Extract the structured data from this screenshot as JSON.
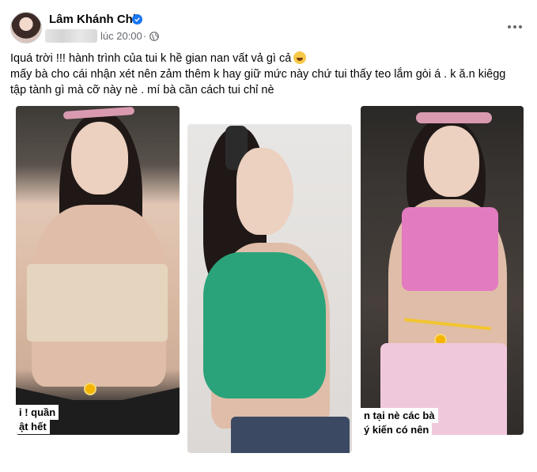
{
  "post": {
    "author_name": "Lâm Khánh Chi",
    "timestamp": "lúc 20:00",
    "separator": "·",
    "caption_lines": [
      "Iquá trời !!! hành trình của tui k hề gian nan vất vả gì cả",
      "mấy bà cho cái nhận xét nên zảm thêm k hay giữ mức này chứ tui thấy teo lắm gòi á . k ă.n kiêgg",
      "tập tành gì mà cỡ này nè . mí bà cần cách tui chỉ nè"
    ]
  },
  "photos": [
    {
      "stickers": [
        "i ! quần",
        "ật hết"
      ]
    },
    {
      "stickers": []
    },
    {
      "stickers": [
        "n tại nè các bà",
        "ý kiến có nên"
      ]
    }
  ],
  "icons": {
    "verified": "verified-badge-icon",
    "privacy": "globe-icon",
    "more": "more-options-icon",
    "caption_emoji": "laughing-emoji-icon"
  },
  "colors": {
    "verified_blue": "#1877f2",
    "secondary_text": "#65676b",
    "primary_text": "#050505"
  }
}
